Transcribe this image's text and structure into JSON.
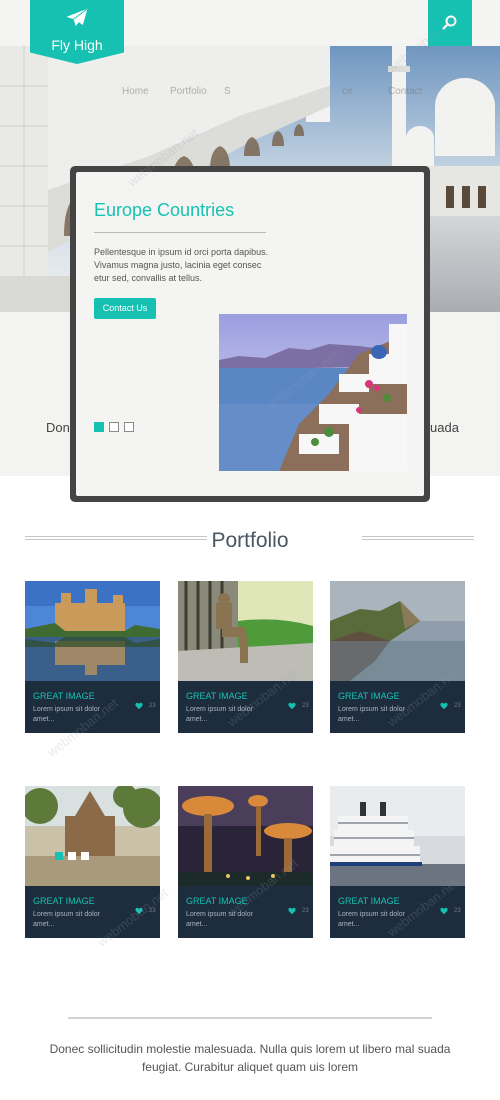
{
  "header": {
    "logo_text": "Fly High"
  },
  "nav": {
    "items": [
      "Home",
      "Portfolio",
      "S",
      "ce",
      "Contact"
    ]
  },
  "hero_band": {
    "left_text": "Donec",
    "right_text": "uada"
  },
  "slider": {
    "title": "Europe Countries",
    "description": "Pellentesque in ipsum id orci porta dapibus. Vivamus magna justo, lacinia eget consec etur sed, convallis at tellus.",
    "button_label": "Contact Us",
    "active_slide": 1,
    "slide_count": 3
  },
  "portfolio": {
    "title": "Portfolio",
    "cards": [
      {
        "title": "GREAT IMAGE",
        "desc": "Lorem ipsum sit dolor amet...",
        "count": "23"
      },
      {
        "title": "GREAT IMAGE",
        "desc": "Lorem ipsum sit dolor amet...",
        "count": "23"
      },
      {
        "title": "GREAT IMAGE",
        "desc": "Lorem ipsum sit dolor amet...",
        "count": "23"
      },
      {
        "title": "GREAT IMAGE",
        "desc": "Lorem ipsum sit dolor amet...",
        "count": "23"
      },
      {
        "title": "GREAT IMAGE",
        "desc": "Lorem ipsum sit dolor amet...",
        "count": "23"
      },
      {
        "title": "GREAT IMAGE",
        "desc": "Lorem ipsum sit dolor amet...",
        "count": "23"
      }
    ]
  },
  "footer": {
    "quote": "Donec sollicitudin molestie malesuada. Nulla quis lorem ut libero mal suada feugiat. Curabitur aliquet quam uis lorem"
  },
  "watermark_text": "webmoban.net",
  "colors": {
    "accent": "#17c1b2",
    "card_bg": "#1d2d3d",
    "modal_frame": "#444444"
  }
}
